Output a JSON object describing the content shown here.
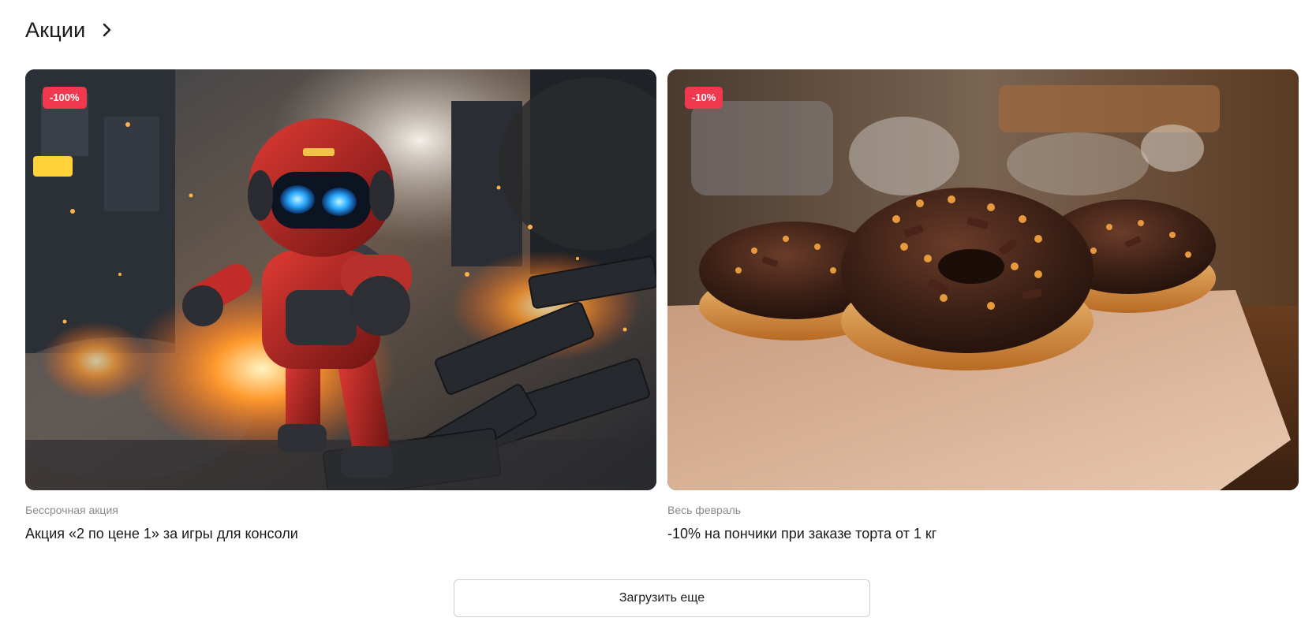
{
  "section": {
    "title": "Акции",
    "arrow_icon": "chevron-right-icon"
  },
  "promos": [
    {
      "badge": "-100%",
      "period": "Бессрочная акция",
      "title": "Акция «2 по цене 1» за игры для консоли",
      "image": "robot-in-explosion-illustration"
    },
    {
      "badge": "-10%",
      "period": "Весь февраль",
      "title": "-10% на пончики при заказе торта от 1 кг",
      "image": "chocolate-donuts-photo"
    }
  ],
  "load_more": {
    "label": "Загрузить еще"
  },
  "colors": {
    "badge_bg": "#f0384f",
    "muted_text": "#8a8a8a"
  }
}
